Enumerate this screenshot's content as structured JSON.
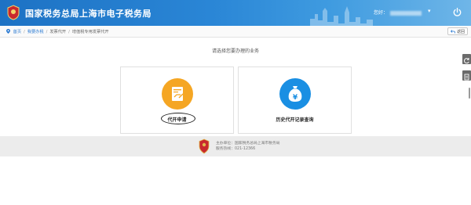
{
  "header": {
    "site_title": "国家税务总局上海市电子税务局",
    "user_label": "您好："
  },
  "breadcrumb": {
    "items": [
      "首页",
      "我要办税",
      "发票代开",
      "增值税专用发票代开"
    ]
  },
  "back_button": {
    "label": "返回"
  },
  "main": {
    "prompt": "请选择您要办理的业务",
    "cards": [
      {
        "label": "代开申请",
        "color": "#f5a623"
      },
      {
        "label": "历史代开记录查询",
        "color": "#1a8fe3"
      }
    ]
  },
  "footer": {
    "host_label": "主办单位：",
    "host_value": "国家税务总局上海市税务局",
    "hotline_label": "服务热线：",
    "hotline_value": "021-12366"
  },
  "colors": {
    "header_blue": "#1d72c4",
    "accent_orange": "#f5a623",
    "accent_blue": "#1a8fe3",
    "footer_bg": "#ececec"
  }
}
